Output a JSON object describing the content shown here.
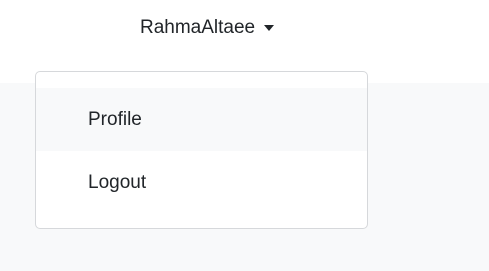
{
  "user_menu": {
    "username": "RahmaAltaee",
    "caret_icon": "caret-down-icon"
  },
  "dropdown": {
    "items": [
      {
        "label": "Profile",
        "highlighted": true
      },
      {
        "label": "Logout",
        "highlighted": false
      }
    ]
  },
  "colors": {
    "panel_background": "#f8f9fa",
    "text": "#212529",
    "menu_border": "#d6d8db"
  }
}
